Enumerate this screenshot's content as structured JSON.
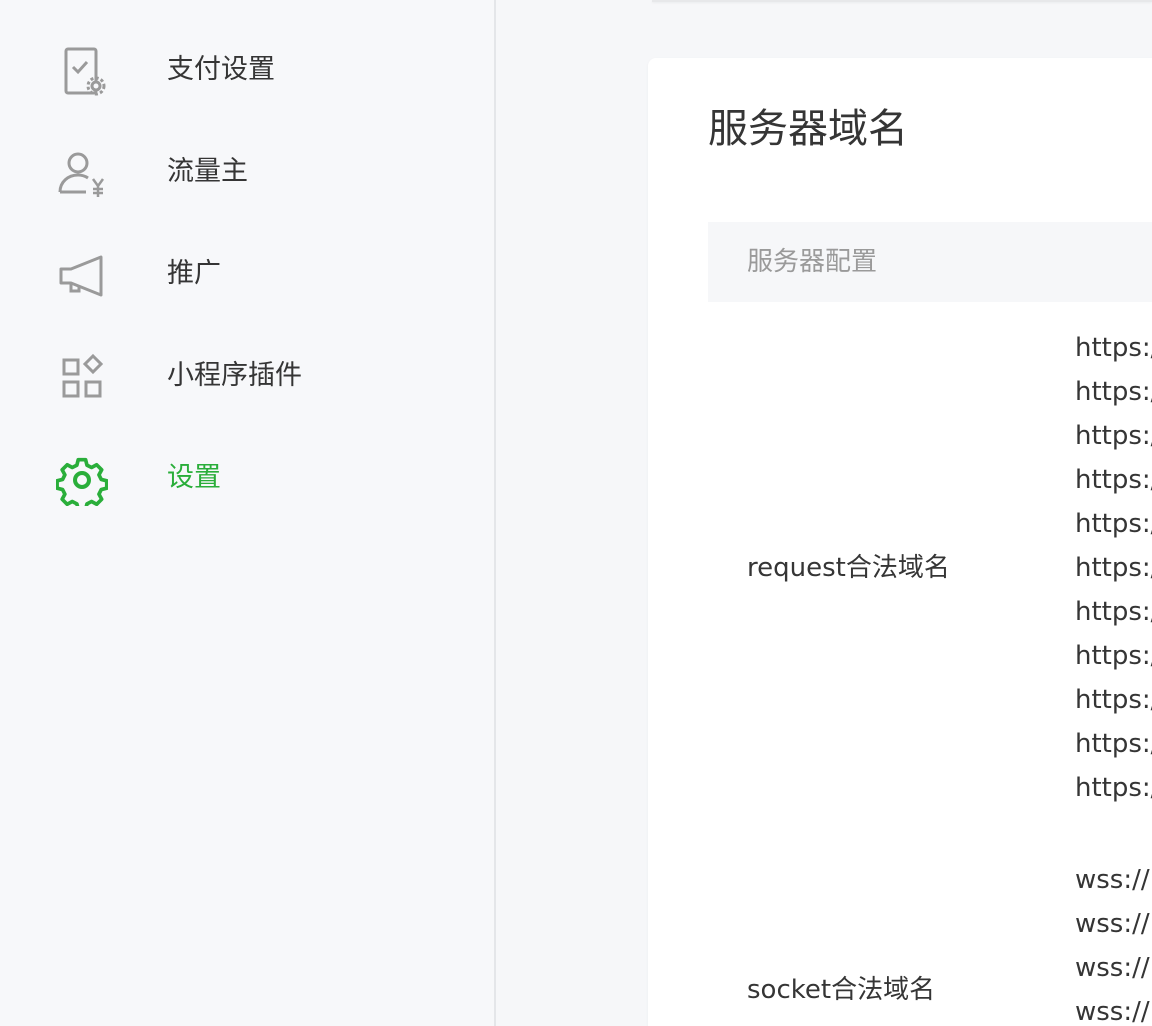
{
  "sidebar": {
    "items": [
      {
        "label": "支付设置",
        "icon": "phone-settings-icon",
        "active": false
      },
      {
        "label": "流量主",
        "icon": "user-yuan-icon",
        "active": false
      },
      {
        "label": "推广",
        "icon": "megaphone-icon",
        "active": false
      },
      {
        "label": "小程序插件",
        "icon": "plugin-grid-icon",
        "active": false
      },
      {
        "label": "设置",
        "icon": "gear-icon",
        "active": true
      }
    ],
    "active_color": "#2aae3a",
    "icon_color": "#9a9a9a"
  },
  "main": {
    "card_title": "服务器域名",
    "table": {
      "header": "服务器配置",
      "rows": [
        {
          "label": "request合法域名",
          "values": [
            "https:/",
            "https:/",
            "https:/",
            "https:/",
            "https:/",
            "https:/",
            "https:/",
            "https:/",
            "https:/",
            "https:/",
            "https:/"
          ]
        },
        {
          "label": "socket合法域名",
          "values": [
            "wss://",
            "wss://",
            "wss://",
            "wss://"
          ]
        }
      ]
    }
  }
}
